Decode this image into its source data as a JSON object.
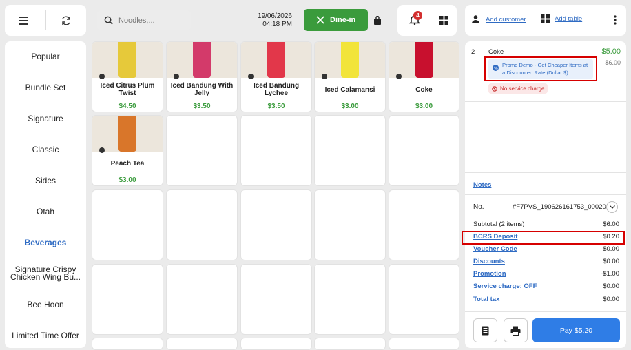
{
  "toolbar": {
    "search_placeholder": "Noodles,...",
    "date": "19/06/2026",
    "time": "04:18 PM",
    "dine_in_label": "Dine-in",
    "notification_count": "4"
  },
  "header_right": {
    "add_customer": "Add customer",
    "add_table": "Add table"
  },
  "categories": [
    {
      "label": "Popular"
    },
    {
      "label": "Bundle Set"
    },
    {
      "label": "Signature"
    },
    {
      "label": "Classic"
    },
    {
      "label": "Sides"
    },
    {
      "label": "Otah"
    },
    {
      "label": "Beverages",
      "active": true
    },
    {
      "label": "Signature Crispy Chicken Wing Bu..."
    },
    {
      "label": "Bee Hoon"
    },
    {
      "label": "Limited Time Offer"
    }
  ],
  "products": [
    {
      "name": "Iced Citrus Plum Twist",
      "price": "$4.50",
      "color": "#e6c93a"
    },
    {
      "name": "Iced Bandung With Jelly",
      "price": "$3.50",
      "color": "#d33a6a"
    },
    {
      "name": "Iced Bandung Lychee",
      "price": "$3.50",
      "color": "#e2374a"
    },
    {
      "name": "Iced Calamansi",
      "price": "$3.00",
      "color": "#f2e43a"
    },
    {
      "name": "Coke",
      "price": "$3.00",
      "color": "#c8102e"
    },
    {
      "name": "Peach Tea",
      "price": "$3.00",
      "color": "#d9762a"
    }
  ],
  "order": {
    "item": {
      "qty": "2",
      "name": "Coke",
      "price": "$5.00",
      "original_price": "$6.00",
      "promo": "Promo Demo - Get Cheaper Items at a Discounted Rate (Dollar $)",
      "no_service": "No service charge"
    },
    "notes_label": "Notes",
    "no_label": "No.",
    "order_no": "#F7PVS_190626161753_00020",
    "subtotal_label": "Subtotal (2 items)",
    "subtotal": "$6.00",
    "bcrs_label": "BCRS Deposit",
    "bcrs": "$0.20",
    "voucher_label": "Voucher Code",
    "voucher": "$0.00",
    "discounts_label": "Discounts",
    "discounts": "$0.00",
    "promotion_label": "Promotion",
    "promotion": "-$1.00",
    "service_label": "Service charge: OFF",
    "service": "$0.00",
    "tax_label": "Total tax",
    "tax": "$0.00",
    "pay_label": "Pay $5.20"
  },
  "colors": {
    "accent": "#2f6bc3",
    "green": "#3a9b3c",
    "highlight": "#d60000"
  }
}
